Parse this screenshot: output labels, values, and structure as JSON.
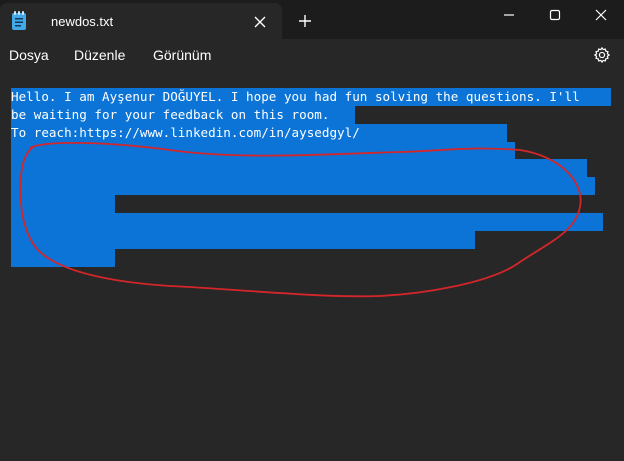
{
  "window": {
    "tab_title": "newdos.txt",
    "controls": [
      "minimize-icon",
      "maximize-icon",
      "close-icon"
    ]
  },
  "menu": {
    "items": [
      "Dosya",
      "Düzenle",
      "Görünüm"
    ]
  },
  "editor": {
    "lines": [
      "Hello. I am Ayşenur DOĞUYEL. I hope you had fun solving the questions. I'll",
      "be waiting for your feedback on this room.",
      "To reach:https://www.linkedin.com/in/aysedgyl/"
    ],
    "selection_color": "#0b74d6",
    "annotation_color": "#d3262a"
  },
  "colors": {
    "title_bar": "#1c1c1c",
    "background": "#272727",
    "text": "#ffffff"
  }
}
